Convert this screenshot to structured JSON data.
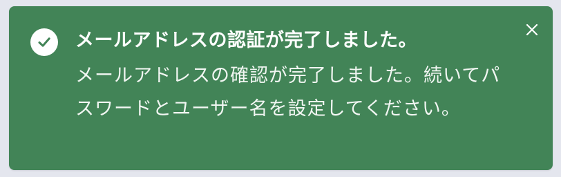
{
  "toast": {
    "title": "メールアドレスの認証が完了しました。",
    "message": "メールアドレスの確認が完了しました。続いてパスワードとユーザー名を設定してください。",
    "status_icon": "check-circle-icon",
    "close_icon": "close-icon"
  },
  "colors": {
    "background": "#e4e6ee",
    "toast_background": "#428457",
    "text": "#ffffff"
  }
}
